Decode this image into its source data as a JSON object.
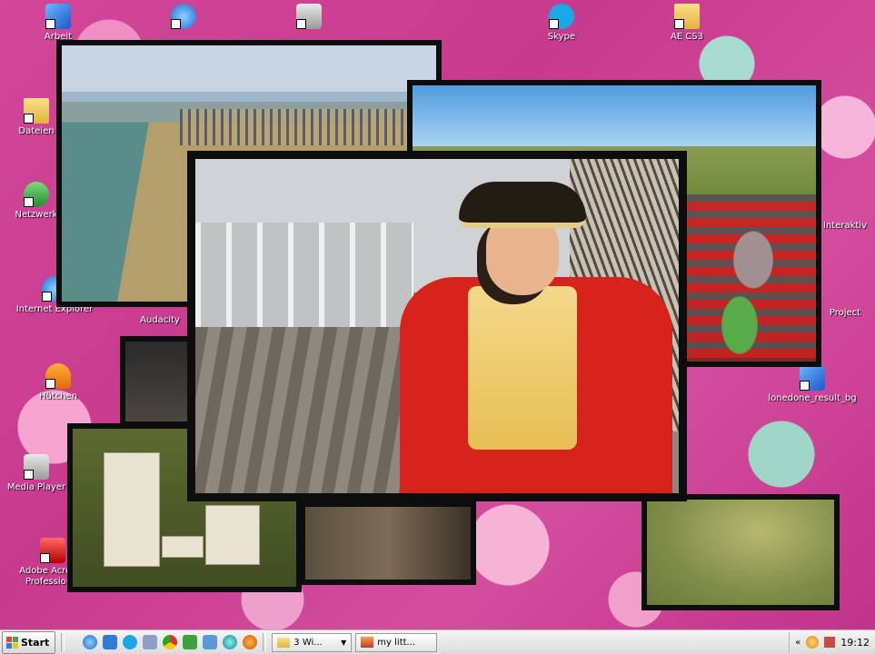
{
  "desktop": {
    "icons": [
      {
        "label": "Arbeit",
        "icon": "computer-icon"
      },
      {
        "label": "",
        "icon": "browser-icon"
      },
      {
        "label": "",
        "icon": "package-icon"
      },
      {
        "label": "Skype",
        "icon": "skype-icon"
      },
      {
        "label": "AE CS3",
        "icon": "folder-icon"
      },
      {
        "label": "Dateien",
        "icon": "folder-icon"
      },
      {
        "label": "Netzwerk",
        "icon": "network-icon"
      },
      {
        "label": "Internet Explorer",
        "icon": "ie-icon"
      },
      {
        "label": "Audacity",
        "icon": "audacity-icon"
      },
      {
        "label": "Hütchen",
        "icon": "vlc-icon"
      },
      {
        "label": "Media Player",
        "icon": "media-player-icon"
      },
      {
        "label": "Adobe Acrobat Professional",
        "icon": "pdf-icon"
      },
      {
        "label": "Interaktiv",
        "icon": "app-icon"
      },
      {
        "label": "Project",
        "icon": "app-icon"
      },
      {
        "label": "lonedone_result_bg",
        "icon": "image-file-icon"
      }
    ]
  },
  "taskbar": {
    "start_label": "Start",
    "tasks": [
      {
        "label": "3 Wi...",
        "icon": "folder-icon"
      },
      {
        "label": "my litt...",
        "icon": "video-icon"
      }
    ],
    "clock": "19:12"
  }
}
